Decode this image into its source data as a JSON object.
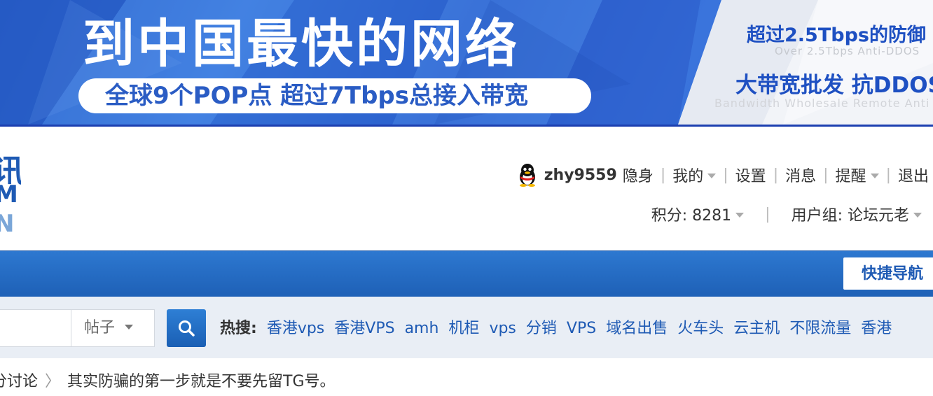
{
  "banner": {
    "headline": "到中国最快的网络",
    "pill_text": "全球9个POP点  超过7Tbps总接入带宽",
    "right_line1": "超过2.5Tbps的防御",
    "right_sub1": "Over 2.5Tbps Anti-DDOS",
    "right_line2": "大带宽批发  抗DDOS",
    "right_sub2": "Bandwidth Wholesale  Remote Anti"
  },
  "logo": {
    "char1": "讯",
    "char2": "M",
    "char3": "N"
  },
  "user_bar": {
    "username": "zhy9559",
    "stealth": "隐身",
    "mine": "我的",
    "settings": "设置",
    "messages": "消息",
    "reminders": "提醒",
    "logout": "退出"
  },
  "stats": {
    "credits": "积分: 8281",
    "group": "用户组: 论坛元老"
  },
  "nav": {
    "quick_nav": "快捷导航"
  },
  "search": {
    "type_label": "帖子",
    "hot_label": "热搜:",
    "hot_terms": [
      "香港vps",
      "香港VPS",
      "amh",
      "机柜",
      "vps",
      "分销",
      "VPS",
      "域名出售",
      "火车头",
      "云主机",
      "不限流量",
      "香港"
    ]
  },
  "breadcrumb": {
    "parent": "分讨论",
    "current": "其实防骗的第一步就是不要先留TG号。"
  }
}
